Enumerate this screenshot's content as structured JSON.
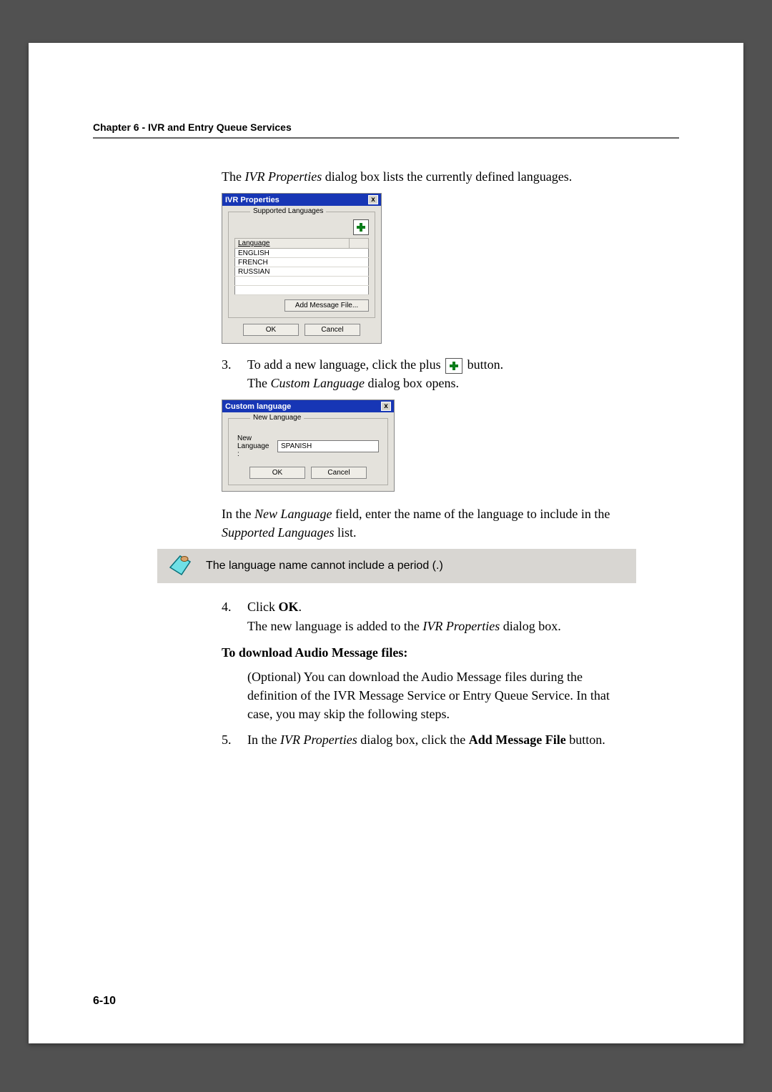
{
  "header": "Chapter 6 - IVR and Entry Queue Services",
  "intro": {
    "pre": "The ",
    "italic": "IVR Properties",
    "post": " dialog box lists the currently defined languages."
  },
  "ivrDialog": {
    "title": "IVR Properties",
    "group": "Supported Languages",
    "col": "Language",
    "rows": [
      "ENGLISH",
      "FRENCH",
      "RUSSIAN"
    ],
    "addFile": "Add Message File...",
    "ok": "OK",
    "cancel": "Cancel"
  },
  "step3": {
    "num": "3.",
    "pre": "To add a new language, click the plus ",
    "post": " button.",
    "line2a": "The ",
    "line2i": "Custom Language",
    "line2b": " dialog box opens."
  },
  "customDialog": {
    "title": "Custom language",
    "legend": "New Language",
    "label": "New Language :",
    "value": "SPANISH",
    "ok": "OK",
    "cancel": "Cancel"
  },
  "afterCustom": {
    "a": "In the ",
    "i1": "New Language",
    "b": " field, enter the name of the language to include in the ",
    "i2": "Supported Languages",
    "c": " list."
  },
  "note": "The language name cannot include a period (.)",
  "step4": {
    "num": "4.",
    "pre": "Click ",
    "bold": "OK",
    "post": ".",
    "line2a": "The new language is added to the ",
    "line2i": "IVR Properties",
    "line2b": " dialog box."
  },
  "audioHead": "To download Audio Message files:",
  "audioPara": "(Optional) You can download the Audio Message files during the definition of the IVR Message Service or Entry Queue Service. In that case, you may skip the following steps.",
  "step5": {
    "num": "5.",
    "a": "In the ",
    "i": "IVR Properties",
    "b": " dialog box, click the ",
    "bold": "Add Message File",
    "c": " button."
  },
  "pageNumber": "6-10"
}
